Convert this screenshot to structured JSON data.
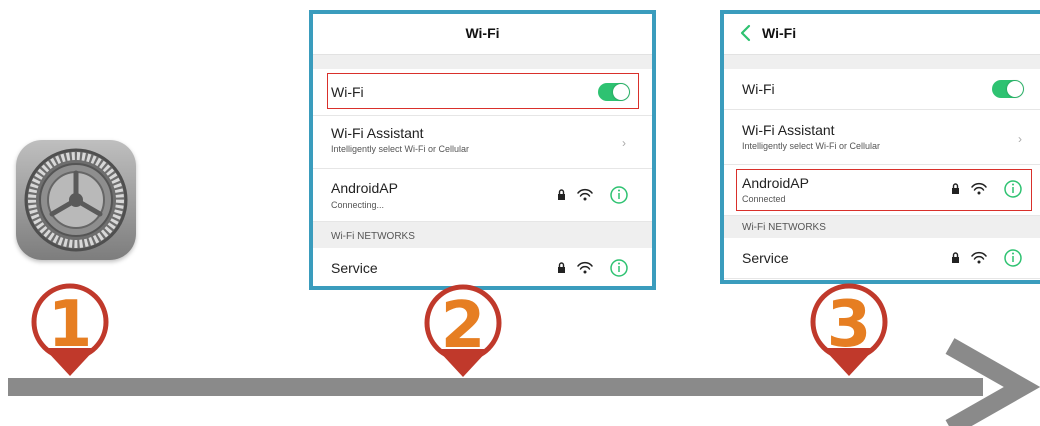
{
  "app_icon": {
    "icon": "settings-gear-icon"
  },
  "steps": [
    "1",
    "2",
    "3"
  ],
  "colors": {
    "accent_border": "#3a9cbd",
    "toggle_on": "#2ec271",
    "highlight": "#d9302b",
    "step_marker": "#c0392b",
    "step_fill": "#e67e22",
    "timeline": "#8a8a8a"
  },
  "screen2": {
    "title": "Wi-Fi",
    "wifi_label": "Wi-Fi",
    "wifi_toggle": "on",
    "assistant_label": "Wi-Fi Assistant",
    "assistant_sub": "Intelligently select Wi-Fi or Cellular",
    "network_name": "AndroidAP",
    "network_status": "Connecting...",
    "section_header": "Wi-Fi NETWORKS",
    "other_network": "Service"
  },
  "screen3": {
    "title": "Wi-Fi",
    "wifi_label": "Wi-Fi",
    "wifi_toggle": "on",
    "assistant_label": "Wi-Fi Assistant",
    "assistant_sub": "Intelligently select Wi-Fi or Cellular",
    "network_name": "AndroidAP",
    "network_status": "Connected",
    "section_header": "Wi-Fi NETWORKS",
    "other_network": "Service"
  }
}
